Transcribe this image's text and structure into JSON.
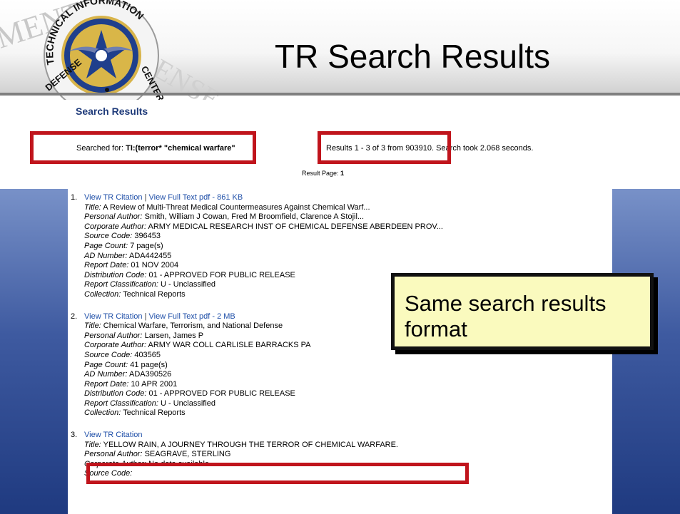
{
  "title": "TR Search Results",
  "seal": {
    "ring_text_top": "TECHNICAL INFORMATION",
    "ring_text_left": "DEFENSE",
    "ring_text_right": "CENTER",
    "background_word_left": "MENT",
    "background_word_right": "ENSE"
  },
  "page": {
    "heading": "Search Results",
    "searched_for_label": "Searched for: ",
    "searched_for_query": "TI:(terror* \"chemical warfare\"",
    "results_summary": "Results 1 - 3 of 3 from 903910. Search took 2.068 seconds.",
    "result_page_label": "Result Page: ",
    "result_page_number": "1"
  },
  "results": [
    {
      "number": "1.",
      "view_citation": "View TR Citation",
      "separator": " | ",
      "view_full_text": "View Full Text pdf - 861 KB",
      "fields": [
        {
          "label": "Title:",
          "value": " A Review of Multi-Threat Medical Countermeasures Against Chemical Warf..."
        },
        {
          "label": "Personal Author:",
          "value": " Smith, William J Cowan, Fred M Broomfield, Clarence A Stojil..."
        },
        {
          "label": "Corporate Author:",
          "value": " ARMY MEDICAL RESEARCH INST OF CHEMICAL DEFENSE ABERDEEN PROV..."
        },
        {
          "label": "Source Code:",
          "value": " 396453"
        },
        {
          "label": "Page Count:",
          "value": " 7 page(s)"
        },
        {
          "label": "AD Number:",
          "value": " ADA442455"
        },
        {
          "label": "Report Date:",
          "value": " 01 NOV 2004"
        },
        {
          "label": "Distribution Code:",
          "value": " 01 - APPROVED FOR PUBLIC RELEASE"
        },
        {
          "label": "Report Classification:",
          "value": " U - Unclassified"
        },
        {
          "label": "Collection:",
          "value": " Technical Reports"
        }
      ]
    },
    {
      "number": "2.",
      "view_citation": "View TR Citation",
      "separator": " | ",
      "view_full_text": "View Full Text pdf - 2 MB",
      "fields": [
        {
          "label": "Title:",
          "value": " Chemical Warfare, Terrorism, and National Defense"
        },
        {
          "label": "Personal Author:",
          "value": " Larsen, James P"
        },
        {
          "label": "Corporate Author:",
          "value": " ARMY WAR COLL CARLISLE BARRACKS PA"
        },
        {
          "label": "Source Code:",
          "value": " 403565"
        },
        {
          "label": "Page Count:",
          "value": " 41 page(s)"
        },
        {
          "label": "AD Number:",
          "value": " ADA390526"
        },
        {
          "label": "Report Date:",
          "value": " 10 APR 2001"
        },
        {
          "label": "Distribution Code:",
          "value": " 01 - APPROVED FOR PUBLIC RELEASE"
        },
        {
          "label": "Report Classification:",
          "value": " U - Unclassified"
        },
        {
          "label": "Collection:",
          "value": " Technical Reports"
        }
      ]
    },
    {
      "number": "3.",
      "view_citation": "View TR Citation",
      "fields": [
        {
          "label": "Title:",
          "value": " YELLOW RAIN, A JOURNEY THROUGH THE TERROR OF CHEMICAL WARFARE."
        },
        {
          "label": "Personal Author:",
          "value": " SEAGRAVE, STERLING"
        },
        {
          "label": "Corporate Author:",
          "value": " No data available"
        },
        {
          "label": "Source Code:",
          "value": ""
        }
      ]
    }
  ],
  "callout": {
    "line1": "Same search results",
    "line2": "format"
  },
  "colors": {
    "highlight": "#c0141c",
    "link": "#1f4fa8",
    "callout_bg": "#fafabe",
    "side_panel": "#3e5aa0"
  }
}
